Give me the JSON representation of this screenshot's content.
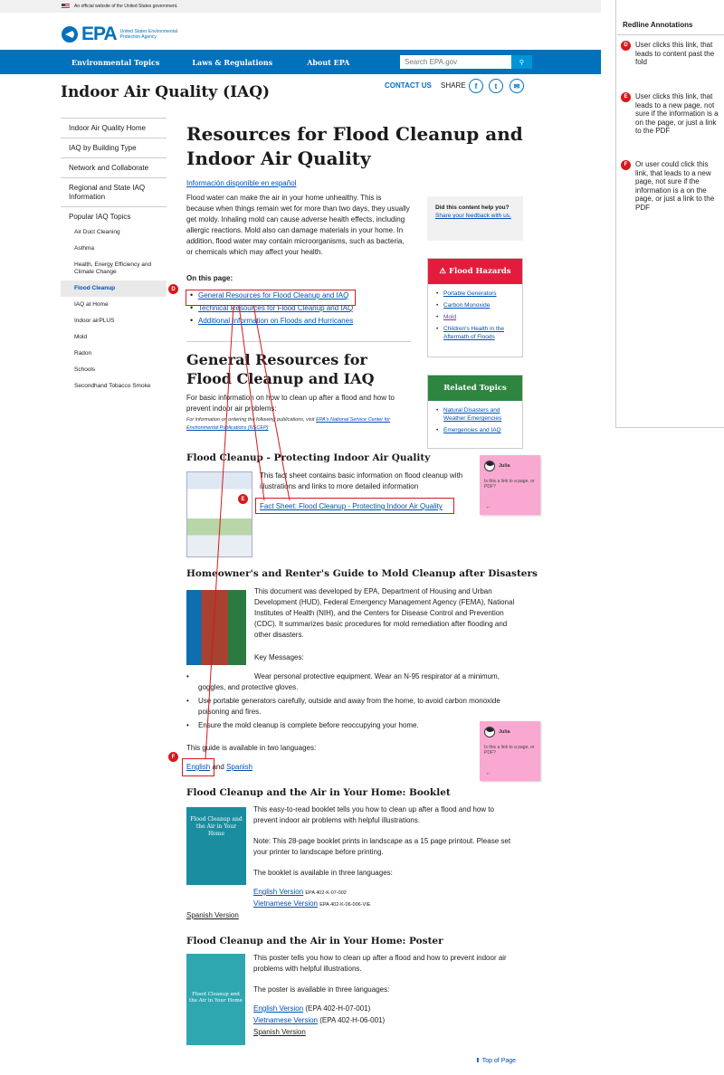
{
  "gov_banner": "An official website of the United States government.",
  "logo": {
    "wordmark": "EPA",
    "agency": "United States Environmental Protection Agency"
  },
  "nav": {
    "items": [
      "Environmental Topics",
      "Laws & Regulations",
      "About EPA"
    ],
    "search_placeholder": "Search EPA.gov"
  },
  "page_title": "Indoor Air Quality (IAQ)",
  "contact": "CONTACT US",
  "share": "SHARE",
  "sidebar": {
    "items": [
      "Indoor Air Quality Home",
      "IAQ by Building Type",
      "Network and Collaborate",
      "Regional and State IAQ Information"
    ],
    "group_title": "Popular IAQ Topics",
    "sub_items": [
      "Air Duct Cleaning",
      "Asthma",
      "Health, Energy Efficiency and Climate Change",
      "Flood Cleanup",
      "IAQ at Home",
      "Indoor airPLUS",
      "Mold",
      "Radon",
      "Schools",
      "Secondhand Tobacco Smoke"
    ]
  },
  "main": {
    "title": "Resources for Flood Cleanup and Indoor Air Quality",
    "spanish_link": "Información disponible en español",
    "intro": "Flood water can make the air in your home unhealthy. This is because when things remain wet for more than two days, they usually get moldy. Inhaling mold can cause adverse health effects, including allergic reactions. Mold also can damage materials in your home. In addition, flood water may contain microorganisms, such as bacteria, or chemicals which may affect your health.",
    "on_this_page": "On this page:",
    "toc": [
      "General Resources for Flood Cleanup and IAQ",
      "Technical Resources for Flood Cleanup and IAQ",
      "Additional Information on Floods and Hurricanes"
    ],
    "section_title": "General Resources for Flood Cleanup and IAQ",
    "section_intro": "For basic information on how to clean up after a flood and how to prevent indoor air problems:",
    "ordering_prefix": "For information on ordering the following publications, visit ",
    "ordering_link": "EPA's National Service Center for Environmental Publications (NSCEP)",
    "factsheet": {
      "title": "Flood Cleanup - Protecting Indoor Air Quality",
      "desc": "This fact sheet contains basic information on flood cleanup with illustrations and links to more detailed information",
      "link": "Fact Sheet: Flood Cleanup - Protecting Indoor Air Quality"
    },
    "mold_guide": {
      "title": "Homeowner's and Renter's Guide to Mold Cleanup after Disasters",
      "desc": "This document was developed by EPA, Department of Housing and Urban Development (HUD), Federal Emergency Management Agency (FEMA), National Institutes of Health (NIH), and the Centers for Disease Control and Prevention (CDC).  It summarizes basic procedures for mold remediation after flooding and other disasters.",
      "key_messages": "Key Messages:",
      "bullets": [
        "Wear personal protective equipment. Wear an N-95 respirator at a minimum, goggles, and protective gloves.",
        "Use portable generators carefully, outside and away from the home, to avoid carbon monoxide poisoning and fires.",
        "Ensure the mold cleanup is complete before reoccupying your home."
      ],
      "languages_note": "This guide is available in two languages:",
      "link_english": "English",
      "and": "and",
      "link_spanish": "Spanish"
    },
    "booklet": {
      "title": "Flood Cleanup and the Air in Your Home: Booklet",
      "desc": "This easy-to-read booklet tells you how to clean up after a flood and how to prevent indoor air problems with helpful illustrations.",
      "note": "Note: This 28-page booklet prints in landscape as a 15 page printout. Please set your printer to landscape before printing.",
      "languages_note": "The booklet is available in three languages:",
      "link_english": "English Version",
      "code_english": "EPA 402-K-07-002",
      "link_vietnamese": "Vietnamese Version",
      "code_vietnamese": "EPA 402-K-06-006-VIE",
      "link_spanish": "Spanish Version",
      "cover": "Flood Cleanup and the Air in Your Home"
    },
    "poster": {
      "title": "Flood Cleanup and the Air in Your Home: Poster",
      "desc": "This poster tells you how to clean up after a flood and how to prevent indoor air problems with helpful illustrations.",
      "languages_note": "The poster is available in three languages:",
      "link_english": "English Version",
      "code_english": "(EPA 402-H-07-001)",
      "link_vietnamese": "Vietnamese Version",
      "code_vietnamese": "(EPA 402-H-06-001)",
      "link_spanish": "Spanish Version",
      "cover": "Flood Cleanup and the Air in Your Home"
    },
    "top_link": "Top of Page"
  },
  "help_box": {
    "question": "Did this content help you?",
    "link": "Share your feedback with us."
  },
  "hazard_box": {
    "title": "Flood Hazards",
    "items": [
      "Portable Generators",
      "Carbon Monoxide",
      "Mold",
      "Children's Health in the Aftermath of Floods"
    ]
  },
  "related_box": {
    "title": "Related Topics",
    "items": [
      "Natural Disasters and Weather Emergencies",
      "Emergencies and IAQ"
    ]
  },
  "stickies": [
    {
      "author": "Julia",
      "text": "Is this a link to a page, or PDF?"
    },
    {
      "author": "Julia",
      "text": "Is this a link to a page, or PDF?"
    }
  ],
  "annotations": {
    "title": "Redline Annotations",
    "items": [
      {
        "marker": "D",
        "text": "User clicks this link, that leads to content past the fold"
      },
      {
        "marker": "E",
        "text": "User clicks this link, that leads to a new page, not sure if the information is a on the page, or just a link to the PDF"
      },
      {
        "marker": "F",
        "text": "Or user could click this link, that leads to a new page, not sure if the information is a on the page, or just a link to the PDF"
      }
    ]
  },
  "colors": {
    "epa_blue": "#0071bc",
    "redline": "#d7191c",
    "hazard_red": "#e31c3d",
    "related_green": "#2e8540",
    "sticky_pink": "#f9a9d1"
  }
}
